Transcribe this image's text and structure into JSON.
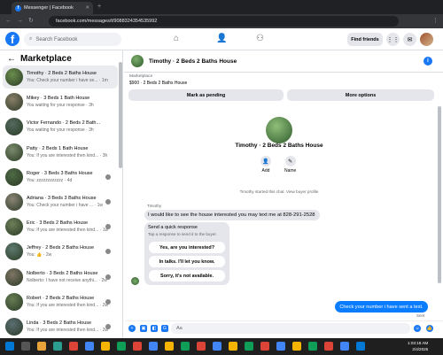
{
  "browser": {
    "tab_title": "Messenger | Facebook",
    "url": "facebook.com/messages/t/9088324354535992"
  },
  "header": {
    "search_placeholder": "Search Facebook",
    "find_friends": "Find friends"
  },
  "sidebar": {
    "title": "Marketplace",
    "items": [
      {
        "name": "Timothy · 2 Beds 2 Baths House",
        "preview": "You: Check your number i have se... · 1m"
      },
      {
        "name": "Mikey · 3 Beds 1 Bath House",
        "preview": "You waiting for your response · 3h"
      },
      {
        "name": "Victor Fernando · 2 Beds 2 Bath...",
        "preview": "You waiting for your response · 3h"
      },
      {
        "name": "Patty · 2 Beds 1 Bath House",
        "preview": "You: If you are interested then kind... · 3h"
      },
      {
        "name": "Roger · 3 Beds 3 Baths House",
        "preview": "You: zzzzzzzzzzzz · 4d"
      },
      {
        "name": "Adriana · 3 Beds 3 Baths House",
        "preview": "You: Check your number i have ... · 1w"
      },
      {
        "name": "Eric · 3 Beds 2 Baths House",
        "preview": "You: If you are interested then kind... · 1w"
      },
      {
        "name": "Jeffrey · 2 Beds 2 Baths House",
        "preview": "You: 👍 · 2w"
      },
      {
        "name": "Nolberto · 3 Beds 2 Baths House",
        "preview": "Nolberto: I have not receive anythi... · 2w"
      },
      {
        "name": "Robert · 2 Beds 2 Baths House",
        "preview": "You: If you are interested then kind... · 2w"
      },
      {
        "name": "Linda · 3 Beds 2 Baths House",
        "preview": "You: If you are interested then kind... · 2w"
      }
    ]
  },
  "conversation": {
    "title": "Timothy · 2 Beds 2 Baths House",
    "marketplace_label": "Marketplace",
    "listing": "$900 · 2 Beds 2 Baths House",
    "mark_pending": "Mark as pending",
    "more_options": "More options",
    "profile_name": "Timothy · 2 Beds 2 Baths House",
    "add_label": "Add",
    "name_label": "Name",
    "started_text": "Timothy started this chat. View buyer profile",
    "sender_name": "Timothy",
    "incoming_message": "I would like to see the house interested you may text me at 828-291-2528",
    "quick_title": "Send a quick response",
    "quick_subtitle": "Tap a response to send it to the buyer.",
    "quick_replies": [
      "Yes, are you interested?",
      "In talks. I'll let you know.",
      "Sorry, it's not available."
    ],
    "outgoing_message": "Check your number i have sent a text.",
    "sent_status": "Sent",
    "composer_placeholder": "Aa"
  },
  "taskbar": {
    "time": "1:03:18 AM",
    "date": "2/4/2025"
  },
  "colors": {
    "accent": "#1877f2",
    "bubble_out": "#0a7cff",
    "bubble_in": "#e4e6eb"
  }
}
